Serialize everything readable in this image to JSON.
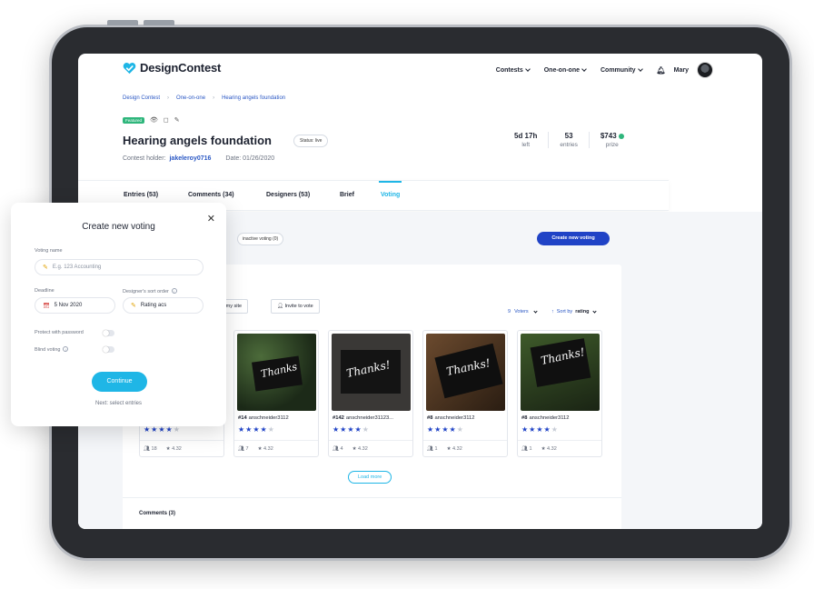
{
  "header": {
    "logo_text": "DesignContest",
    "nav": [
      "Contests",
      "One-on-one",
      "Community"
    ],
    "user_name": "Mary"
  },
  "breadcrumb": [
    "Design Contest",
    "One-on-one",
    "Hearing angels foundation"
  ],
  "badge_featured": "Featured",
  "contest": {
    "title": "Hearing angels foundation",
    "status": "Status: live",
    "holder_label": "Contest holder:",
    "holder_name": "jakeleroy0716",
    "date": "Date: 01/26/2020"
  },
  "stats": [
    {
      "value": "5d 17h",
      "label": "left"
    },
    {
      "value": "53",
      "label": "entries"
    },
    {
      "value": "$743",
      "label": "prize"
    }
  ],
  "tabs": [
    "Entries (53)",
    "Comments (34)",
    "Designers (53)",
    "Brief",
    "Voting"
  ],
  "voting": {
    "inactive_pill": "inactive voting (0)",
    "create_button": "Create new voting",
    "on_site_label": "ll on my site",
    "invite_label": "Invite to vote",
    "voters_count": "9",
    "voters_label": "Voters",
    "sort_label": "Sort by",
    "sort_value": "rating",
    "load_more": "Load more",
    "comments_heading": "Comments (3)"
  },
  "cards": [
    {
      "num": "",
      "designer": "",
      "rating": 4,
      "votes": "18",
      "score": "4.32"
    },
    {
      "num": "#14",
      "designer": "anschneider3112",
      "rating": 4,
      "votes": "7",
      "score": "4.32"
    },
    {
      "num": "#142",
      "designer": "anschneider31123...",
      "rating": 4,
      "votes": "4",
      "score": "4.32"
    },
    {
      "num": "#8",
      "designer": "anschneider3112",
      "rating": 4,
      "votes": "1",
      "score": "4.32"
    },
    {
      "num": "#8",
      "designer": "anschneider3112",
      "rating": 4,
      "votes": "1",
      "score": "4.32"
    }
  ],
  "modal": {
    "title": "Create new voting",
    "voting_name_label": "Voting name",
    "voting_name_placeholder": "E.g. 123 Accounting",
    "deadline_label": "Deadline",
    "deadline_value": "5 Nov 2020",
    "sort_order_label": "Designer's sort order",
    "sort_order_value": "Rating acs",
    "protect_label": "Protect with password",
    "blind_label": "Blind voting",
    "continue": "Continue",
    "next_hint": "Next: select entries"
  },
  "colors": {
    "accent": "#1fb6e6",
    "primary": "#2043c6",
    "featured": "#2fb67c"
  }
}
